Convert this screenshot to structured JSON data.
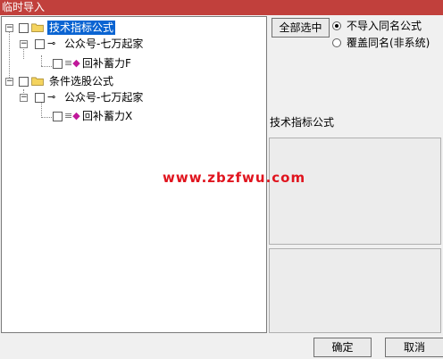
{
  "window": {
    "title": "临时导入"
  },
  "tree": {
    "roots": [
      {
        "label": "技术指标公式",
        "selected": true,
        "child": {
          "label": "公众号-七万起家",
          "leaf": "回补蓄力F"
        }
      },
      {
        "label": "条件选股公式",
        "selected": false,
        "child": {
          "label": "公众号-七万起家",
          "leaf": "回补蓄力X"
        }
      }
    ]
  },
  "buttons": {
    "select_all": "全部选中",
    "ok": "确定",
    "cancel": "取消"
  },
  "options": {
    "no_import_same": "不导入同名公式",
    "overwrite_same": "覆盖同名(非系统)",
    "selected": "no_import_same"
  },
  "preview": {
    "label": "技术指标公式"
  },
  "watermark": {
    "text": "www.zbzfwu.com"
  },
  "colors": {
    "titlebar": "#c1403c",
    "selection": "#0a64d2",
    "watermark": "#e0141e"
  }
}
